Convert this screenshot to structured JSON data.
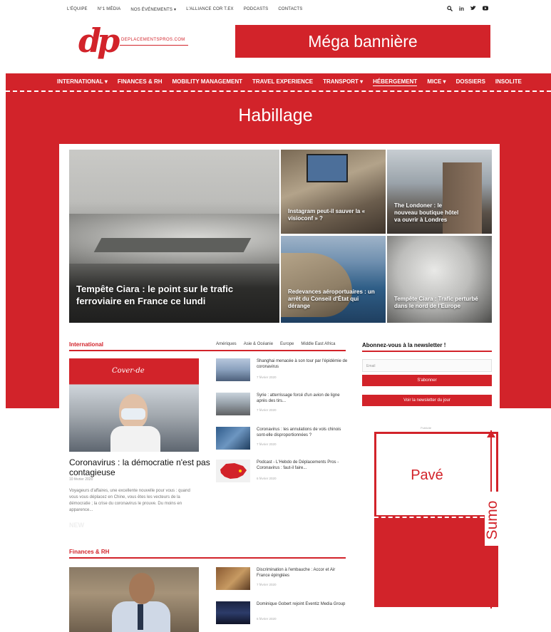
{
  "top_nav": {
    "links": [
      "L'équipe",
      "N°1 Média",
      "Nos événements ▾",
      "L'alliance COR T.EX",
      "Podcasts",
      "Contacts"
    ],
    "icons": [
      "search-icon",
      "linkedin-icon",
      "twitter-icon",
      "youtube-icon"
    ]
  },
  "logo": {
    "mark": "dp",
    "domain": "DEPLACEMENTSPROS.COM"
  },
  "mega_banner": {
    "label": "Méga bannière"
  },
  "main_menu": {
    "items": [
      "International ▾",
      "Finances & RH",
      "Mobility Management",
      "Travel Experience",
      "Transport ▾",
      "Hébergement",
      "MICE ▾",
      "Dossiers",
      "Insolite"
    ]
  },
  "habillage": {
    "label": "Habillage"
  },
  "hero": {
    "main": "Tempête Ciara : le point sur le trafic ferroviaire en France ce lundi",
    "insta": "Instagram peut-il sauver la « visioconf » ?",
    "london": "The Londoner : le nouveau boutique hôtel va ouvrir à Londres",
    "aero": "Redevances aéroportuaires : un arrêt du Conseil d'État qui dérange",
    "tempete2": "Tempête Ciara : Trafic perturbé dans le nord de l'Europe"
  },
  "international": {
    "title": "International",
    "filters": [
      "Amériques",
      "Asie & Océanie",
      "Europe",
      "Middle East Africa"
    ],
    "featured": {
      "brand": "Cover-de",
      "title": "Coronavirus : la démocratie n'est pas contagieuse",
      "date": "10 février 2020",
      "excerpt": "Voyageurs d'affaires, une excellente nouvelle pour vous : quand vous vous déplacez en Chine, vous êtes les vecteurs de la démocratie ; la crise du coronavirus le prouve. Du moins en apparence...",
      "badge": "NEW"
    },
    "list": [
      {
        "title": "Shanghai menacée à son tour par l'épidémie de coronavirus",
        "date": "7 février 2020"
      },
      {
        "title": "Syrie : atterrissage forcé d'un avion de ligne après des tirs...",
        "date": "7 février 2020"
      },
      {
        "title": "Coronavirus : les annulations de vols chinois sont-elle disproportionnées ?",
        "date": "7 février 2020"
      },
      {
        "title": "Podcast - L'Hebdo de Déplacements Pros - Coronavirus : faut-il faire...",
        "date": "6 février 2020"
      }
    ]
  },
  "newsletter": {
    "title": "Abonnez-vous à la newsletter !",
    "placeholder": "Email",
    "subscribe": "S'abonner",
    "today": "Voir la newsletter du jour"
  },
  "ads": {
    "pub_label": "Publicité",
    "pave": "Pavé",
    "sumo": "Sumo"
  },
  "finances": {
    "title": "Finances & RH",
    "list": [
      {
        "title": "Discrimination à l'embauche : Accor et Air France épinglées",
        "date": "7 février 2020"
      },
      {
        "title": "Dominique Gobert rejoint Eventiz Media Group",
        "date": "6 février 2020"
      }
    ]
  },
  "colors": {
    "brand_red": "#d2232a",
    "white": "#ffffff"
  }
}
